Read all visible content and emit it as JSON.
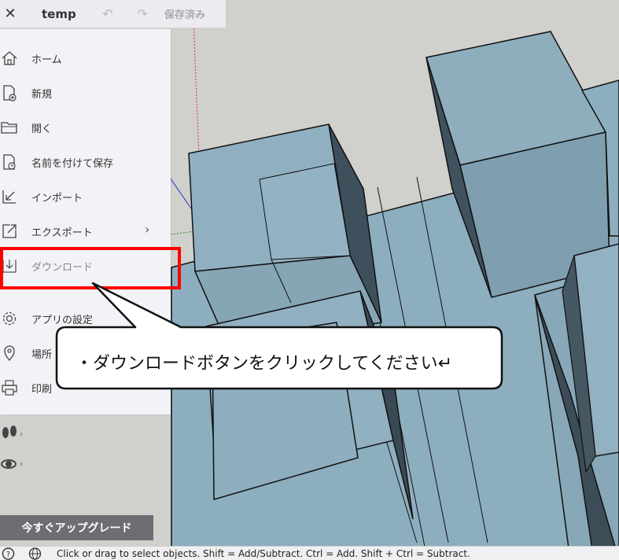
{
  "topbar": {
    "close_icon": "close-icon",
    "title": "temp",
    "undo_icon": "undo-icon",
    "redo_icon": "redo-icon",
    "status": "保存済み"
  },
  "menu": {
    "items": [
      {
        "label": "ホーム",
        "icon": "home-icon"
      },
      {
        "label": "新規",
        "icon": "new-file-icon"
      },
      {
        "label": "開く",
        "icon": "folder-open-icon"
      },
      {
        "label": "名前を付けて保存",
        "icon": "save-as-icon"
      },
      {
        "label": "インポート",
        "icon": "import-icon"
      },
      {
        "label": "エクスポート",
        "icon": "export-icon"
      },
      {
        "label": "ダウンロード",
        "icon": "download-icon"
      },
      {
        "label": "アプリの設定",
        "icon": "gear-icon"
      },
      {
        "label": "場所",
        "icon": "location-pin-icon"
      },
      {
        "label": "印刷",
        "icon": "printer-icon"
      }
    ]
  },
  "upgrade": {
    "label": "今すぐアップグレード"
  },
  "statusbar": {
    "help_icon": "help-icon",
    "globe_icon": "globe-icon",
    "message": "Click or drag to select objects. Shift = Add/Subtract. Ctrl = Add. Shift + Ctrl = Subtract."
  },
  "annotation": {
    "callout_text": "・ダウンロードボタンをクリックしてください↵",
    "highlight_color": "#ff0000"
  },
  "colors": {
    "building_top": "#8fafbf",
    "building_side": "#80a0b1",
    "building_dark": "#41535e",
    "sky": "#d0d0cc"
  }
}
